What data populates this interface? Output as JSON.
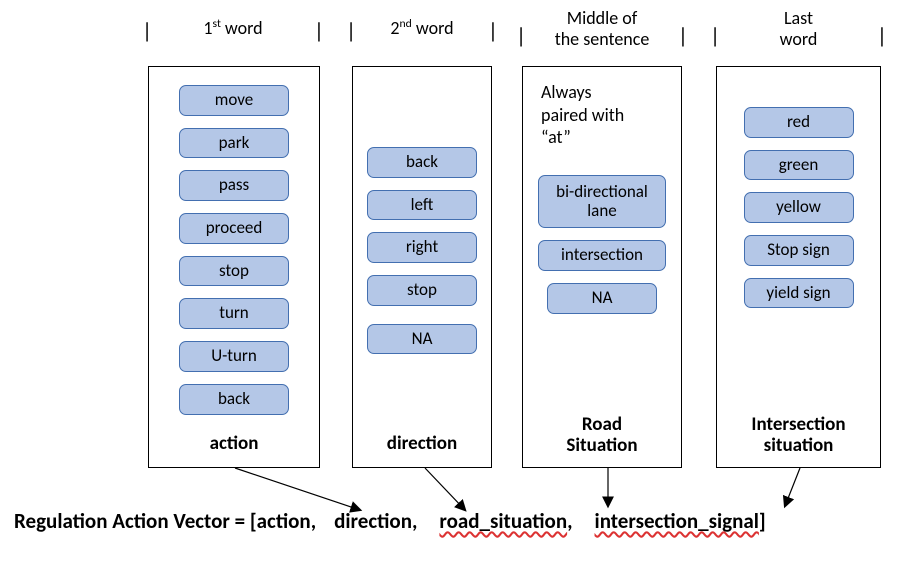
{
  "columns": {
    "c1": {
      "header_html": "1<sup>st</sup> word",
      "items": [
        "move",
        "park",
        "pass",
        "proceed",
        "stop",
        "turn",
        "U-turn",
        "back"
      ],
      "bottom": "action"
    },
    "c2": {
      "header_html": "2<sup>nd</sup> word",
      "items": [
        "back",
        "left",
        "right",
        "stop",
        "NA"
      ],
      "bottom": "direction"
    },
    "c3": {
      "header_top": "Middle of",
      "header_bot": "the sentence",
      "note_l1": "Always",
      "note_l2": "paired with",
      "note_l3": "“at”",
      "items": [
        "bi-directional lane",
        "intersection",
        "NA"
      ],
      "bottom_top": "Road",
      "bottom_bot": "Situation"
    },
    "c4": {
      "header_top": "Last",
      "header_bot": "word",
      "items": [
        "red",
        "green",
        "yellow",
        "Stop sign",
        "yield sign"
      ],
      "bottom_top": "Intersection",
      "bottom_bot": "situation"
    }
  },
  "vector": {
    "prefix": "Regulation Action Vector = [",
    "p1": "action",
    "p2": "direction",
    "p3": "road_situation",
    "p4": "intersection_signal",
    "suffix": "]"
  }
}
